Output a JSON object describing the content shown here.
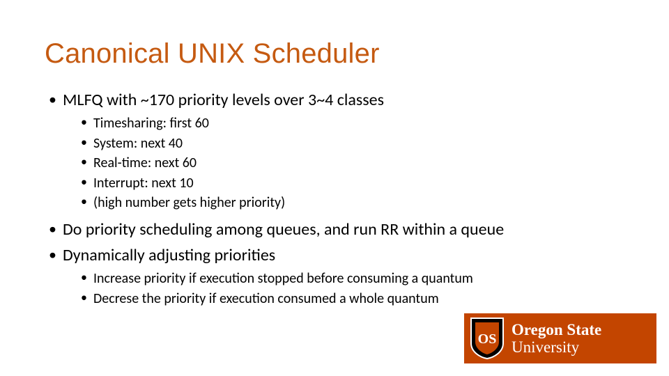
{
  "title": "Canonical UNIX Scheduler",
  "bullets": [
    {
      "text": "MLFQ with ~170 priority levels over 3~4 classes",
      "sub": [
        "Timesharing: first 60",
        "System: next 40",
        "Real-time: next 60",
        "Interrupt: next 10",
        "(high number gets higher priority)"
      ]
    },
    {
      "text": "Do priority scheduling among queues, and run RR within a queue",
      "sub": []
    },
    {
      "text": "Dynamically adjusting priorities",
      "sub": [
        "Increase priority if execution stopped before consuming a quantum",
        "Decrese the priority if execution consumed a whole quantum"
      ]
    }
  ],
  "logo": {
    "line1": "Oregon State",
    "line2": "University",
    "brand_color": "#C34500"
  }
}
